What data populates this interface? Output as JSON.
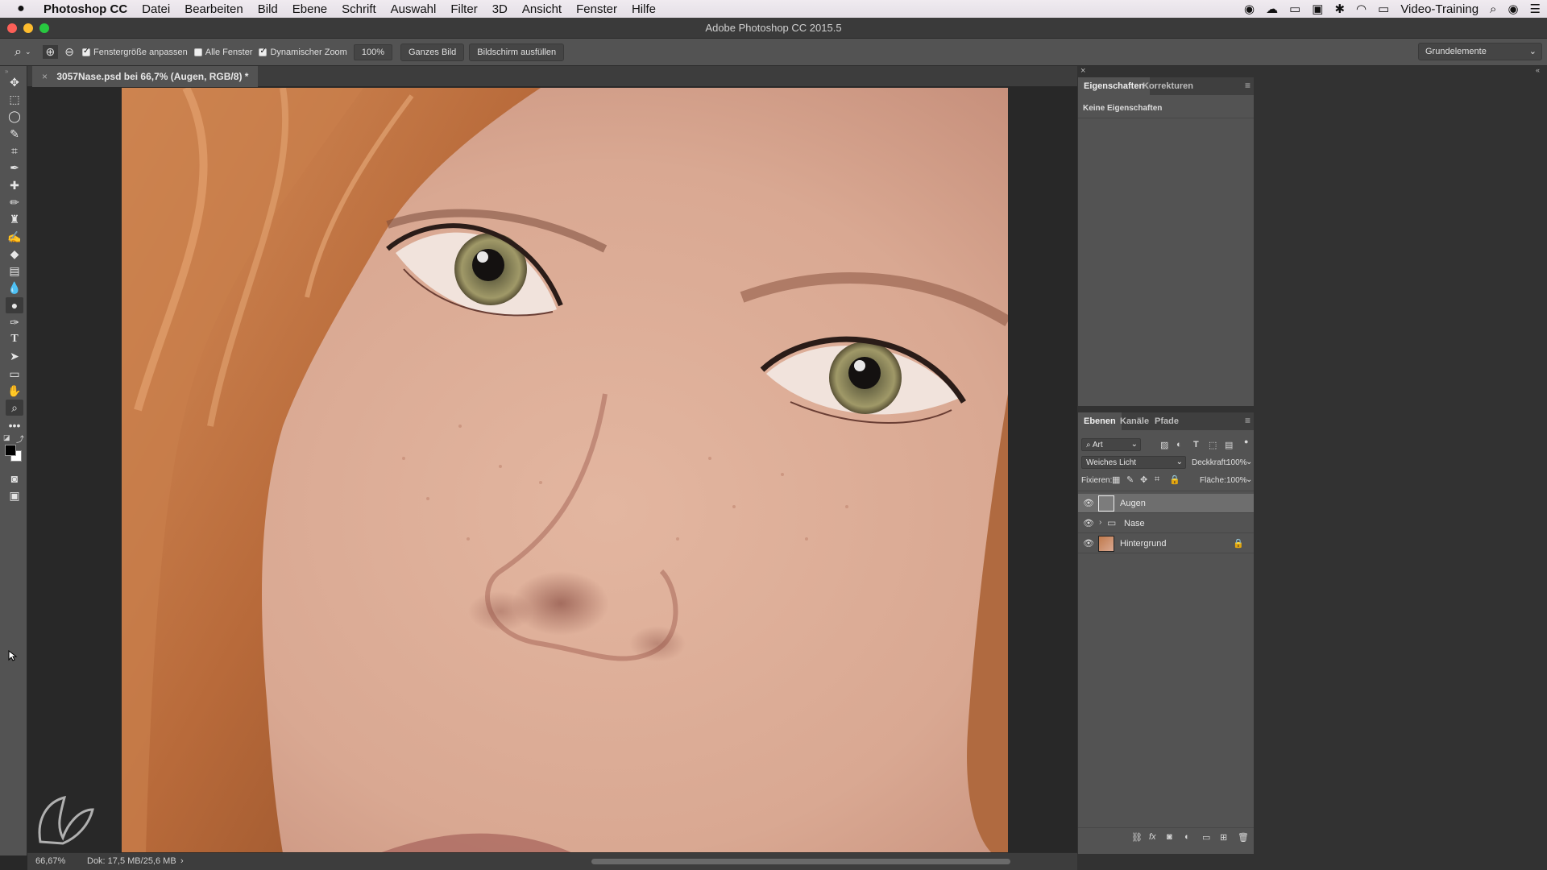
{
  "menubar": {
    "app_name": "Photoshop CC",
    "items": [
      "Datei",
      "Bearbeiten",
      "Bild",
      "Ebene",
      "Schrift",
      "Auswahl",
      "Filter",
      "3D",
      "Ansicht",
      "Fenster",
      "Hilfe"
    ],
    "user": "Video-Training"
  },
  "window": {
    "title": "Adobe Photoshop CC 2015.5"
  },
  "options_bar": {
    "fit_window_label": "Fenstergröße anpassen",
    "fit_window_checked": true,
    "all_windows_label": "Alle Fenster",
    "all_windows_checked": false,
    "dynamic_zoom_label": "Dynamischer Zoom",
    "dynamic_zoom_checked": true,
    "zoom_percent": "100%",
    "fit_screen_button": "Ganzes Bild",
    "fill_screen_button": "Bildschirm ausfüllen",
    "workspace": "Grundelemente"
  },
  "document": {
    "tab_title": "3057Nase.psd bei 66,7% (Augen, RGB/8) *",
    "zoom": "66,67%",
    "doc_size": "Dok: 17,5 MB/25,6 MB"
  },
  "properties_panel": {
    "tabs": [
      "Eigenschaften",
      "Korrekturen"
    ],
    "empty_text": "Keine Eigenschaften"
  },
  "layers_panel": {
    "tabs": [
      "Ebenen",
      "Kanäle",
      "Pfade"
    ],
    "filter_kind": "Art",
    "blend_mode": "Weiches Licht",
    "opacity_label": "Deckkraft:",
    "opacity_value": "100%",
    "lock_label": "Fixieren:",
    "fill_label": "Fläche:",
    "fill_value": "100%",
    "layers": [
      {
        "name": "Augen",
        "type": "layer",
        "selected": true,
        "visible": true,
        "locked": false
      },
      {
        "name": "Nase",
        "type": "group",
        "selected": false,
        "visible": true,
        "locked": false
      },
      {
        "name": "Hintergrund",
        "type": "image",
        "selected": false,
        "visible": true,
        "locked": true
      }
    ]
  },
  "tools": [
    "move-tool",
    "marquee-tool",
    "lasso-tool",
    "quick-selection-tool",
    "crop-tool",
    "eyedropper-tool",
    "healing-brush-tool",
    "brush-tool",
    "clone-stamp-tool",
    "history-brush-tool",
    "eraser-tool",
    "gradient-tool",
    "blur-tool",
    "dodge-tool",
    "pen-tool",
    "type-tool",
    "path-selection-tool",
    "rectangle-tool",
    "hand-tool",
    "zoom-tool",
    "more-tools"
  ],
  "colors": {
    "panel_bg": "#535353",
    "dark_bg": "#282828",
    "foreground_swatch": "#000000",
    "background_swatch": "#ffffff"
  }
}
